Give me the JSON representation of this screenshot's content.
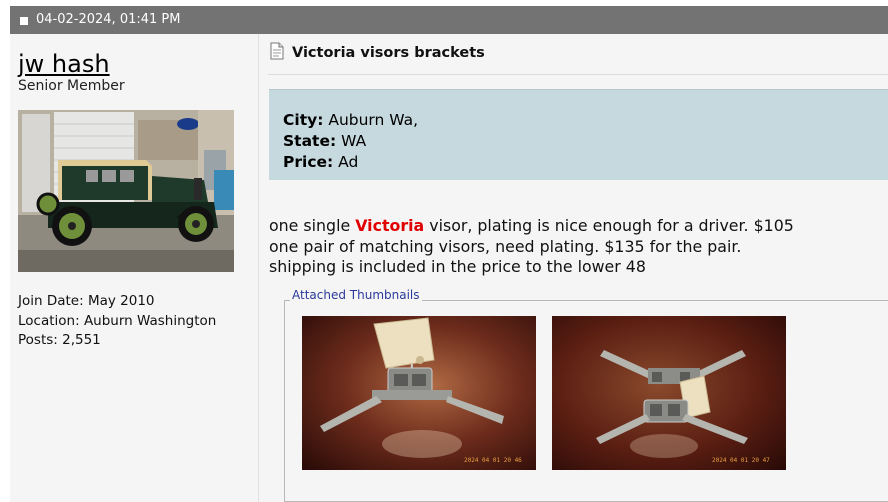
{
  "post": {
    "date": "04-02-2024, 01:41 PM"
  },
  "user": {
    "name": "jw hash",
    "title": "Senior Member",
    "join_date": "Join Date: May 2010",
    "location": "Location: Auburn Washington",
    "posts": "Posts: 2,551"
  },
  "title": "Victoria visors brackets",
  "info": {
    "city_label": "City:",
    "city_value": "Auburn Wa,",
    "state_label": "State:",
    "state_value": "WA",
    "price_label": "Price:",
    "price_value": "Ad"
  },
  "message": {
    "line1_pre": "one single ",
    "line1_highlight": "Victoria",
    "line1_post": " visor, plating is nice enough for a driver. $105",
    "line2": "one pair of matching visors, need plating. $135 for the pair.",
    "line3": "shipping is included in the price to the lower 48"
  },
  "attachments": {
    "legend": "Attached Thumbnails",
    "thumbs": [
      {
        "stamp": "2024 04 01 20 46"
      },
      {
        "stamp": "2024 04 01 20 47"
      }
    ]
  },
  "colors": {
    "header_bar": "#737373",
    "info_box": "#c6d9df",
    "highlight": "#e00000",
    "legend_text": "#2a3a9a"
  }
}
